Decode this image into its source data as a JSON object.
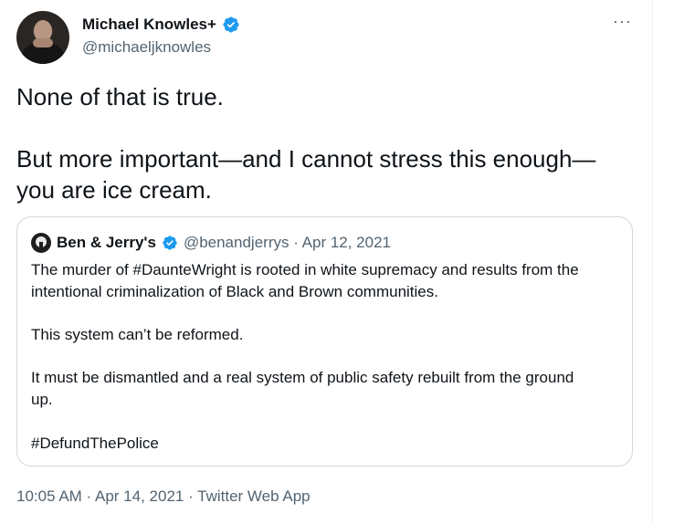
{
  "author": {
    "display_name": "Michael Knowles+",
    "handle": "@michaeljknowles"
  },
  "more_label": "···",
  "tweet_text": {
    "line1": "None of that is true.",
    "line2": "But more important—and I cannot stress this enough—",
    "line3": "you are ice cream."
  },
  "quoted": {
    "display_name": "Ben & Jerry's",
    "handle_date": "@benandjerrys · Apr 12, 2021",
    "lines": [
      "The murder of #DaunteWright is rooted in white supremacy and results from the",
      "intentional criminalization of Black and Brown communities.",
      "This system can’t be reformed.",
      "It must be dismantled and a real system of public safety rebuilt from the ground",
      "up.",
      "#DefundThePolice"
    ]
  },
  "footer": "10:05 AM · Apr 14, 2021 · Twitter Web App",
  "colors": {
    "verified": "#1d9bf0",
    "secondary_text": "#536471",
    "border": "#cfd9de"
  }
}
